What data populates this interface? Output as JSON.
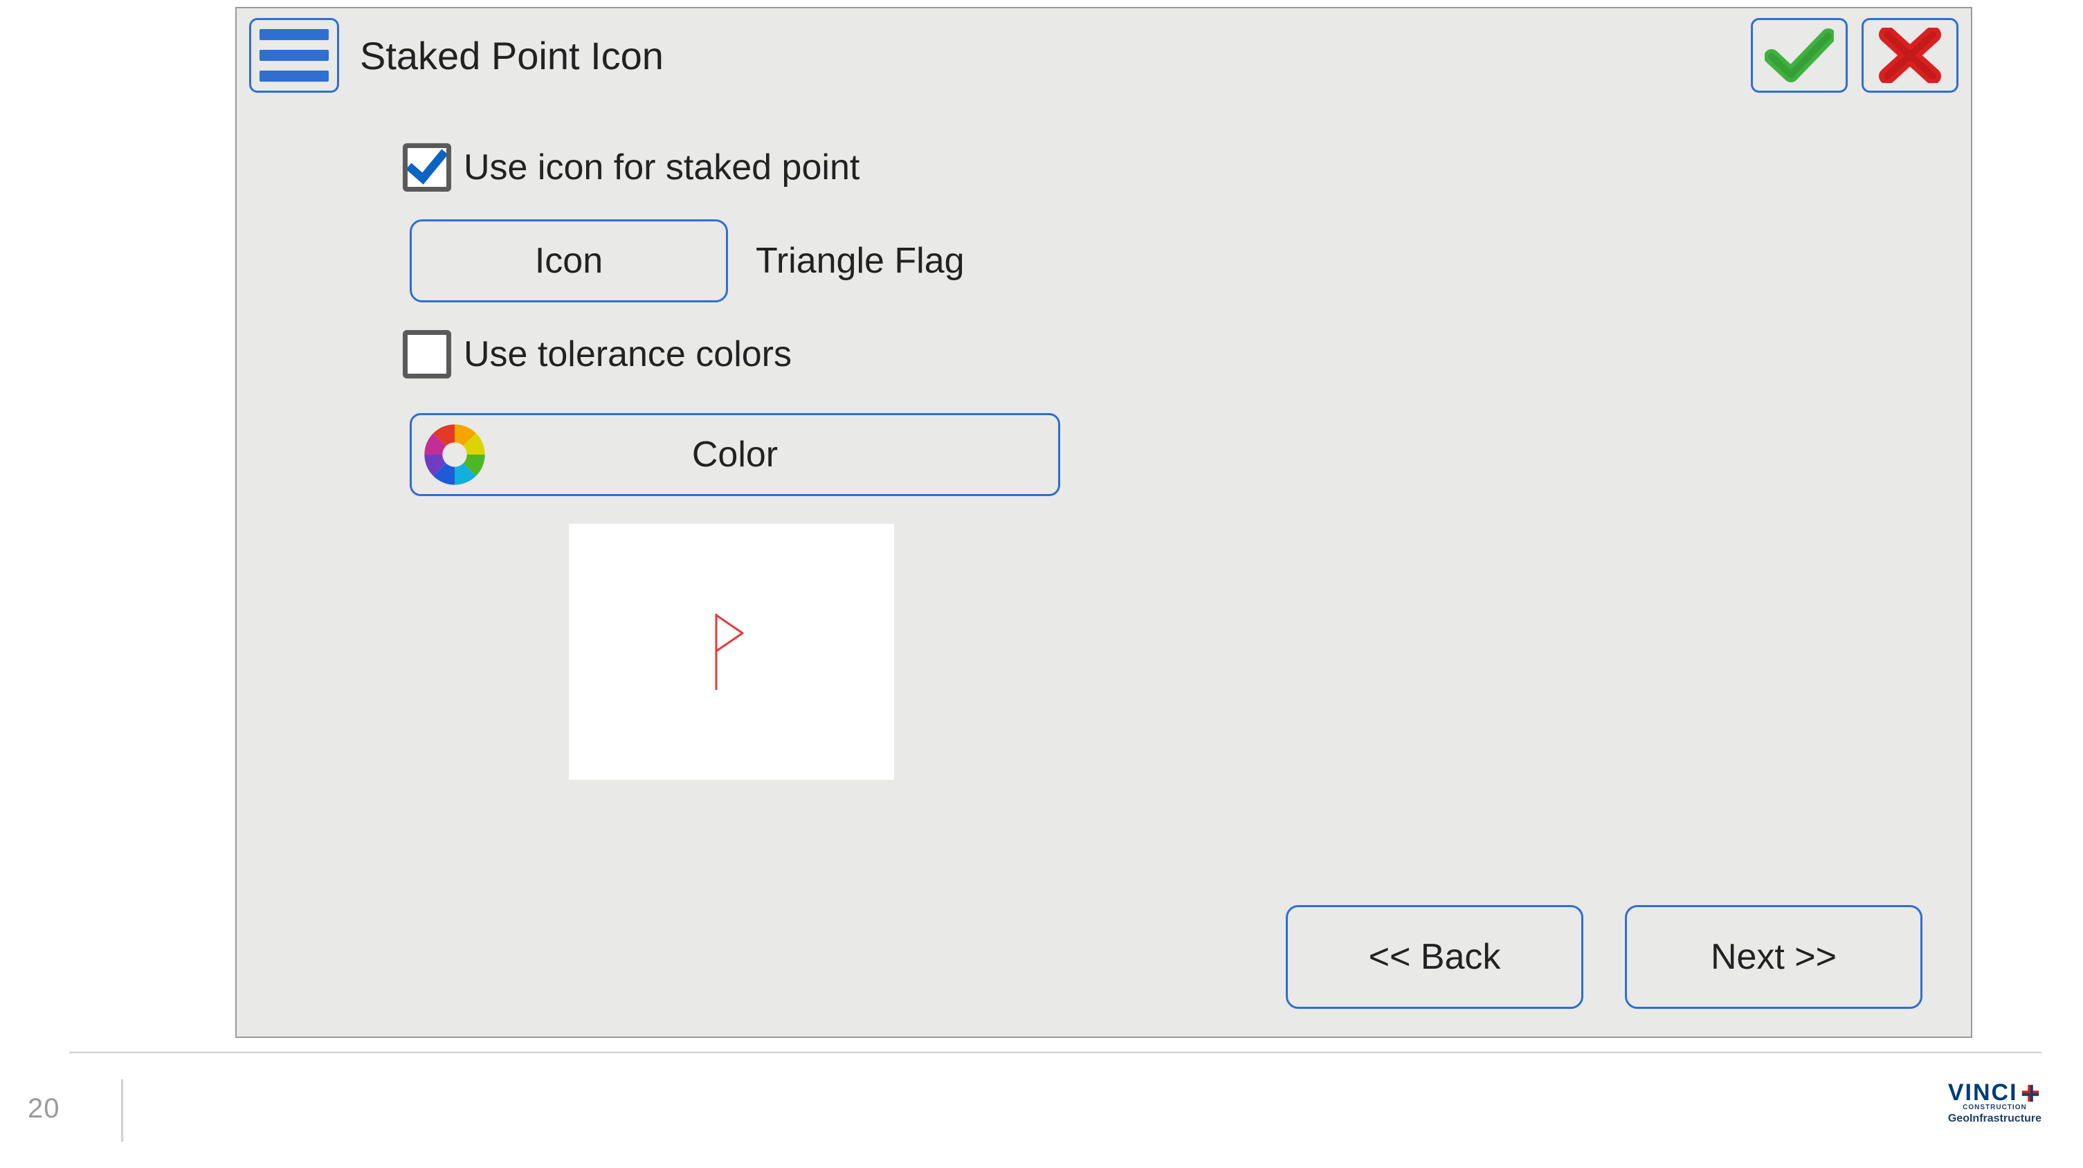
{
  "header": {
    "title": "Staked Point Icon"
  },
  "form": {
    "use_icon": {
      "label": "Use icon for staked point",
      "checked": true
    },
    "icon_button_label": "Icon",
    "selected_icon_name": "Triangle Flag",
    "use_tolerance_colors": {
      "label": "Use tolerance colors",
      "checked": false
    },
    "color_button_label": "Color"
  },
  "nav": {
    "back_label": "<< Back",
    "next_label": "Next >>"
  },
  "footer": {
    "page_number": "20",
    "brand_name": "VINCI",
    "brand_sub1": "CONSTRUCTION",
    "brand_sub2": "GeoInfrastructure"
  }
}
